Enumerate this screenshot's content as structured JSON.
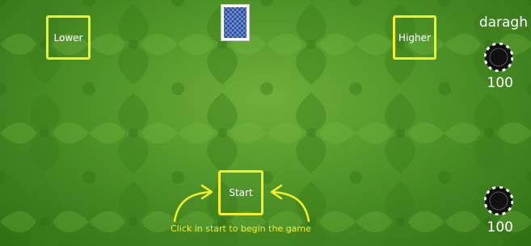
{
  "buttons": {
    "lower_label": "Lower",
    "higher_label": "Higher",
    "start_label": "Start"
  },
  "instruction": "Click in start to begin the game",
  "players": [
    {
      "name": "daragh",
      "chips": "100"
    },
    {
      "name": "",
      "chips": "100"
    }
  ],
  "colors": {
    "highlight": "#f2ee2a",
    "table": "#4f9428",
    "card_back": "#2a4fa8"
  },
  "icons": {
    "card": "card-back-icon",
    "chip": "poker-chip-icon",
    "arrow": "curved-arrow-icon"
  }
}
